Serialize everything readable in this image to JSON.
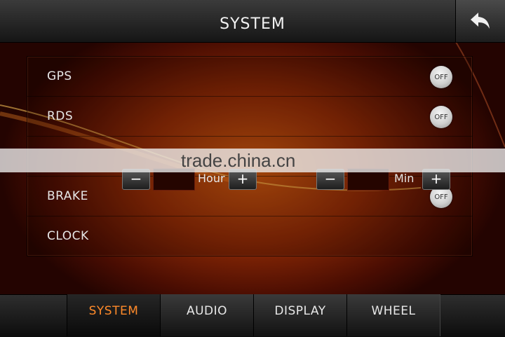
{
  "header": {
    "title": "SYSTEM"
  },
  "settings": {
    "gps": {
      "label": "GPS",
      "state": "OFF"
    },
    "rds": {
      "label": "RDS",
      "state": "OFF"
    },
    "brake": {
      "label": "BRAKE",
      "state": "OFF"
    },
    "clock": {
      "label": "CLOCK",
      "hour_unit": "Hour",
      "min_unit": "Min",
      "hour_value": "",
      "min_value": "",
      "minus": "−",
      "plus": "+"
    }
  },
  "watermark": "trade.china.cn",
  "tabs": [
    {
      "label": "SYSTEM",
      "active": true
    },
    {
      "label": "AUDIO"
    },
    {
      "label": "DISPLAY"
    },
    {
      "label": "WHEEL"
    }
  ],
  "colors": {
    "accent": "#ff8a2a",
    "background": "#8d2a06"
  },
  "icons": {
    "back": "back-arrow-icon"
  }
}
